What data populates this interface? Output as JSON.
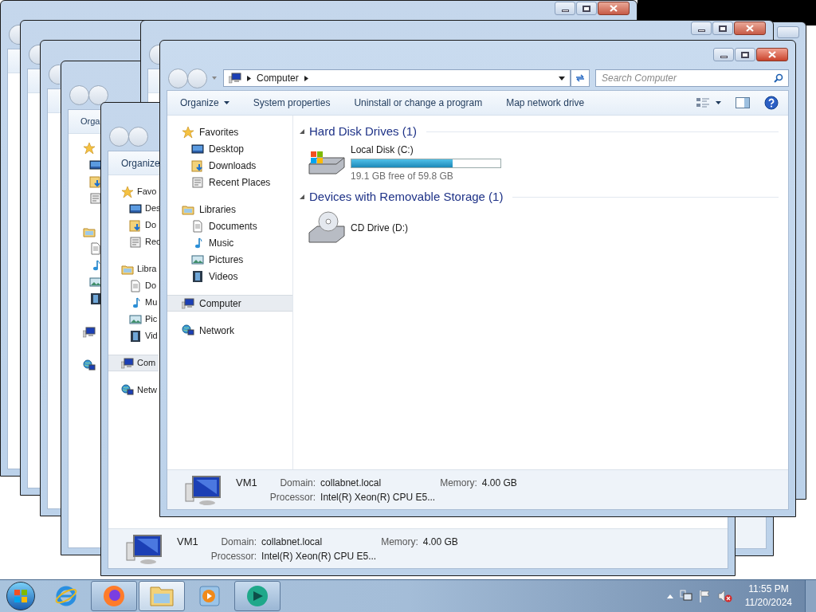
{
  "front_window": {
    "address": [
      "Computer"
    ],
    "search_placeholder": "Search Computer",
    "toolbar": [
      {
        "label": "Organize",
        "kind": "menu"
      },
      {
        "label": "System properties",
        "kind": "command"
      },
      {
        "label": "Uninstall or change a program",
        "kind": "command"
      },
      {
        "label": "Map network drive",
        "kind": "command"
      }
    ],
    "nav": [
      {
        "label": "Favorites",
        "kind": "favorites",
        "selected": false,
        "children": [
          {
            "label": "Desktop",
            "kind": "desktop",
            "selected": false
          },
          {
            "label": "Downloads",
            "kind": "downloads",
            "selected": false
          },
          {
            "label": "Recent Places",
            "kind": "recent",
            "selected": false
          }
        ]
      },
      {
        "label": "Libraries",
        "kind": "libraries",
        "selected": false,
        "children": [
          {
            "label": "Documents",
            "kind": "documents",
            "selected": false
          },
          {
            "label": "Music",
            "kind": "music",
            "selected": false
          },
          {
            "label": "Pictures",
            "kind": "pictures",
            "selected": false
          },
          {
            "label": "Videos",
            "kind": "videos",
            "selected": false
          }
        ]
      },
      {
        "label": "Computer",
        "kind": "computer",
        "selected": true
      },
      {
        "label": "Network",
        "kind": "network",
        "selected": false
      }
    ],
    "groups": [
      {
        "title": "Hard Disk Drives (1)",
        "expanded": true,
        "items": [
          {
            "kind": "hard-disk",
            "name": "Local Disk (C:)",
            "level": 0.68,
            "space": "19.1 GB free of 59.8 GB"
          }
        ]
      },
      {
        "title": "Devices with Removable Storage (1)",
        "expanded": true,
        "items": [
          {
            "kind": "cd-drive",
            "name": "CD Drive (D:)"
          }
        ]
      }
    ],
    "details": {
      "name": "VM1",
      "domain_label": "Domain:",
      "domain": "collabnet.local",
      "memory_label": "Memory:",
      "memory": "4.00 GB",
      "processor_label": "Processor:",
      "processor": "Intel(R) Xeon(R) CPU E5..."
    }
  },
  "behind_window": {
    "toolbar": "Organize",
    "nav": [
      {
        "label": "Favo",
        "kind": "favorites",
        "selected": false,
        "children": [
          {
            "label": "Des",
            "kind": "desktop",
            "selected": false
          },
          {
            "label": "Do",
            "kind": "downloads",
            "selected": false
          },
          {
            "label": "Rec",
            "kind": "recent",
            "selected": false
          }
        ]
      },
      {
        "label": "Libra",
        "kind": "libraries",
        "selected": false,
        "children": [
          {
            "label": "Do",
            "kind": "documents",
            "selected": false
          },
          {
            "label": "Mu",
            "kind": "music",
            "selected": false
          },
          {
            "label": "Pic",
            "kind": "pictures",
            "selected": false
          },
          {
            "label": "Vid",
            "kind": "videos",
            "selected": false
          }
        ]
      },
      {
        "label": "Com",
        "kind": "computer",
        "selected": true
      },
      {
        "label": "Netw",
        "kind": "network",
        "selected": false
      }
    ],
    "details": {
      "name": "VM1",
      "domain_label": "Domain:",
      "domain": "collabnet.local",
      "memory_label": "Memory:",
      "memory": "4.00 GB",
      "processor_label": "Processor:",
      "processor": "Intel(R) Xeon(R) CPU E5..."
    }
  },
  "back_window_toolbar": "Orga",
  "taskbar": {
    "apps": [
      {
        "kind": "ie",
        "running": false,
        "active": false
      },
      {
        "kind": "firefox",
        "running": true,
        "active": false
      },
      {
        "kind": "explorer",
        "running": true,
        "active": true
      },
      {
        "kind": "media",
        "running": false,
        "active": false
      },
      {
        "kind": "app",
        "running": true,
        "active": false
      }
    ],
    "time": "11:55 PM",
    "date": "11/20/2024"
  }
}
